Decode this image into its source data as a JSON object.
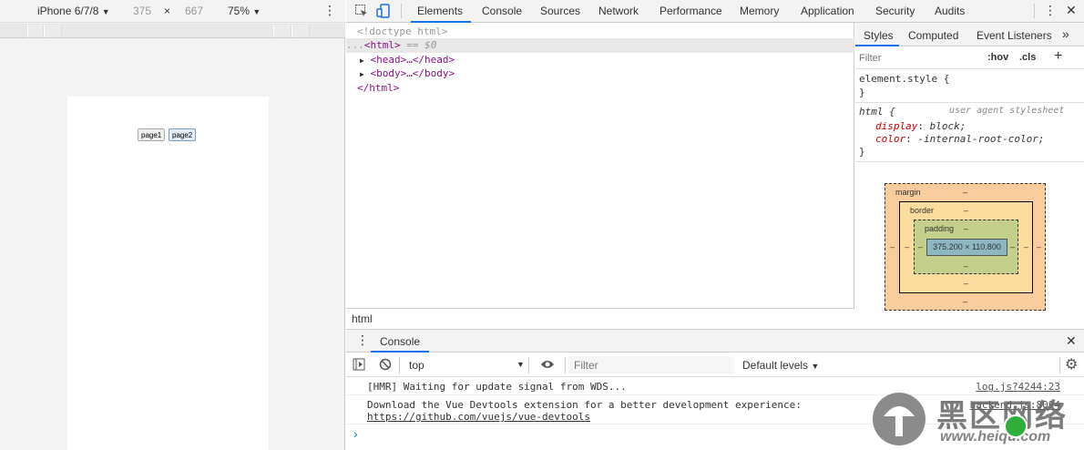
{
  "device_toolbar": {
    "device": "iPhone 6/7/8",
    "device_caret": "▼",
    "width": "375",
    "times": "×",
    "height": "667",
    "zoom": "75%",
    "zoom_caret": "▼",
    "more": "⋮"
  },
  "page": {
    "buttons": [
      "page1",
      "page2"
    ]
  },
  "devtools_tabs": [
    "Elements",
    "Console",
    "Sources",
    "Network",
    "Performance",
    "Memory",
    "Application",
    "Security",
    "Audits"
  ],
  "devtools_icons": {
    "more": "⋮",
    "close": "✕"
  },
  "elements": {
    "doctype": "<!doctype html>",
    "html_open": "<html>",
    "eq0": "== $0",
    "dots": "...",
    "head": "<head>…</head>",
    "body": "<body>…</body>",
    "html_close": "</html>",
    "breadcrumb": "html"
  },
  "styles": {
    "tabs": [
      "Styles",
      "Computed",
      "Event Listeners"
    ],
    "more_tabs": "»",
    "filter_placeholder": "Filter",
    "hov": ":hov",
    "cls": ".cls",
    "add": "+",
    "element_style": "element.style {",
    "close_brace": "}",
    "html_selector": "html {",
    "ua": "user agent stylesheet",
    "prop1_name": "display",
    "prop1_value": "block;",
    "prop2_name": "color",
    "prop2_value": "-internal-root-color;"
  },
  "box_model": {
    "margin_label": "margin",
    "border_label": "border",
    "padding_label": "padding",
    "dash": "–",
    "content": "375.200 × 110.800",
    "colors": {
      "margin": "#f9cc9d",
      "border": "#fcdb9e",
      "padding": "#c3cf8a",
      "content": "#8cb6c0"
    }
  },
  "console": {
    "title": "Console",
    "context": "top",
    "context_caret": "▼",
    "filter_placeholder": "Filter",
    "levels": "Default levels",
    "levels_caret": "▼",
    "messages": [
      {
        "text": "[HMR] Waiting for update signal from WDS...",
        "source": "log.js?4244:23"
      },
      {
        "text": "Download the Vue Devtools extension for a better development experience:",
        "link": "https://github.com/vuejs/vue-devtools",
        "source": "backend.js:8094"
      }
    ],
    "prompt": "›"
  },
  "watermark": {
    "text": "黑区网络",
    "url": "www.heiqu.com"
  }
}
